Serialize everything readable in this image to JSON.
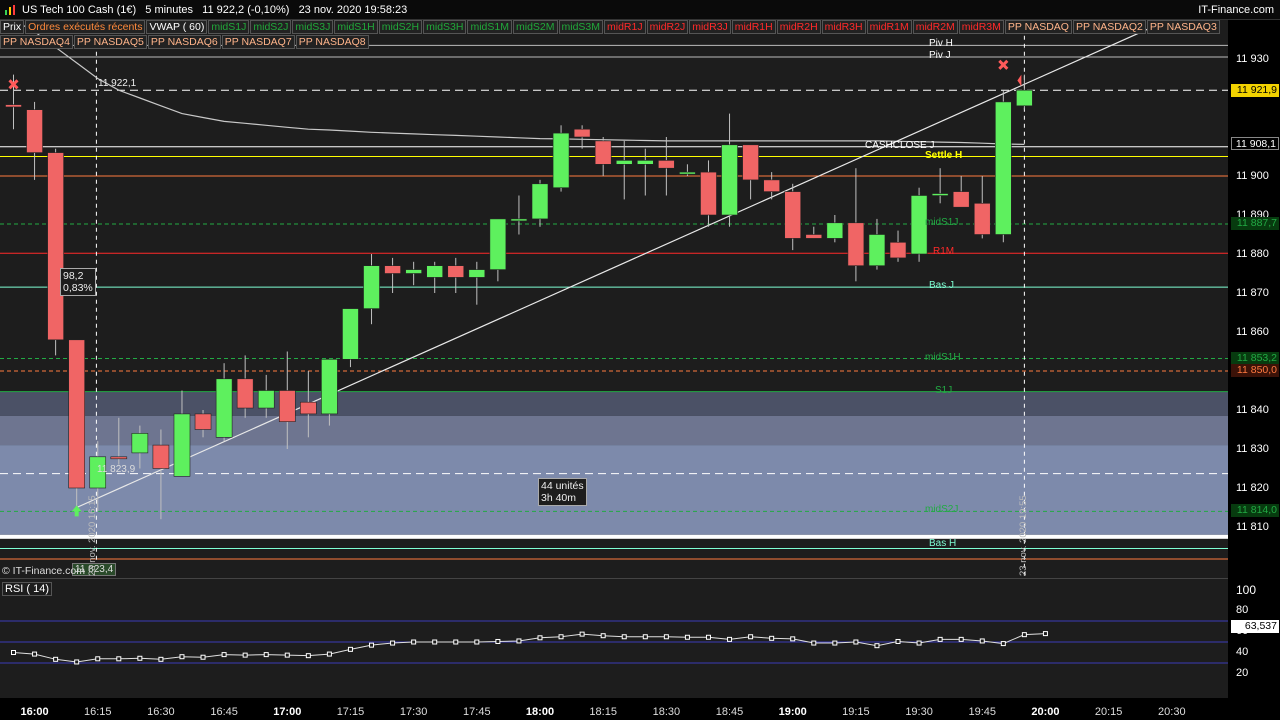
{
  "window": {
    "title": "US Tech 100 Cash (1€)   5 minutes   11 922,2 (-0,10%)   23 nov. 2020 19:58:23",
    "brand": "IT-Finance.com"
  },
  "toolbar": [
    {
      "label": "Prix",
      "color": "white"
    },
    {
      "label": "Ordres exécutés récents",
      "color": "orange"
    },
    {
      "label": "VWAP ( 60)",
      "color": "white"
    },
    {
      "label": "midS1J",
      "color": "green"
    },
    {
      "label": "midS2J",
      "color": "green"
    },
    {
      "label": "midS3J",
      "color": "green"
    },
    {
      "label": "midS1H",
      "color": "green"
    },
    {
      "label": "midS2H",
      "color": "green"
    },
    {
      "label": "midS3H",
      "color": "green"
    },
    {
      "label": "midS1M",
      "color": "green"
    },
    {
      "label": "midS2M",
      "color": "green"
    },
    {
      "label": "midS3M",
      "color": "green"
    },
    {
      "label": "midR1J",
      "color": "red"
    },
    {
      "label": "midR2J",
      "color": "red"
    },
    {
      "label": "midR3J",
      "color": "red"
    },
    {
      "label": "midR1H",
      "color": "red"
    },
    {
      "label": "midR2H",
      "color": "red"
    },
    {
      "label": "midR3H",
      "color": "red"
    },
    {
      "label": "midR1M",
      "color": "red"
    },
    {
      "label": "midR2M",
      "color": "red"
    },
    {
      "label": "midR3M",
      "color": "red"
    },
    {
      "label": "PP NASDAQ",
      "color": "paleorange"
    },
    {
      "label": "PP NASDAQ2",
      "color": "paleorange"
    },
    {
      "label": "PP NASDAQ3",
      "color": "paleorange"
    },
    {
      "label": "PP NASDAQ4",
      "color": "paleorange"
    },
    {
      "label": "PP NASDAQ5",
      "color": "paleorange"
    },
    {
      "label": "PP NASDAQ6",
      "color": "paleorange"
    },
    {
      "label": "PP NASDAQ7",
      "color": "paleorange"
    },
    {
      "label": "PP NASDAQ8",
      "color": "paleorange"
    }
  ],
  "price_axis": {
    "ticks": [
      "11 930",
      "11 900",
      "11 890",
      "11 880",
      "11 870",
      "11 860",
      "11 840",
      "11 830",
      "11 820",
      "11 810"
    ],
    "tick_values": [
      11930,
      11900,
      11890,
      11880,
      11870,
      11860,
      11840,
      11830,
      11820,
      11810
    ]
  },
  "price_boxes": [
    {
      "label": "11 921,9",
      "value": 11921.9,
      "bg": "#f2d200",
      "fg": "#000"
    },
    {
      "label": "11 908,1",
      "value": 11908.1,
      "bg": "#000000",
      "fg": "#ffffff"
    },
    {
      "label": "11 887,7",
      "value": 11887.7,
      "bg": "#073b0f",
      "fg": "#22aa44"
    },
    {
      "label": "11 853,2",
      "value": 11853.2,
      "bg": "#073b0f",
      "fg": "#22aa44"
    },
    {
      "label": "11 850,0",
      "value": 11850.0,
      "bg": "#3b1208",
      "fg": "#ff7a40"
    },
    {
      "label": "11 814,0",
      "value": 11814.0,
      "bg": "#073b0f",
      "fg": "#22aa44"
    }
  ],
  "time_axis": [
    {
      "label": "16:00",
      "bold": true
    },
    {
      "label": "16:15",
      "bold": false
    },
    {
      "label": "16:30",
      "bold": false
    },
    {
      "label": "16:45",
      "bold": false
    },
    {
      "label": "17:00",
      "bold": true
    },
    {
      "label": "17:15",
      "bold": false
    },
    {
      "label": "17:30",
      "bold": false
    },
    {
      "label": "17:45",
      "bold": false
    },
    {
      "label": "18:00",
      "bold": true
    },
    {
      "label": "18:15",
      "bold": false
    },
    {
      "label": "18:30",
      "bold": false
    },
    {
      "label": "18:45",
      "bold": false
    },
    {
      "label": "19:00",
      "bold": true
    },
    {
      "label": "19:15",
      "bold": false
    },
    {
      "label": "19:30",
      "bold": false
    },
    {
      "label": "19:45",
      "bold": false
    },
    {
      "label": "20:00",
      "bold": true
    },
    {
      "label": "20:15",
      "bold": false
    },
    {
      "label": "20:30",
      "bold": false
    }
  ],
  "level_labels": [
    {
      "label": "Piv H",
      "value": 11933.5,
      "color": "#ffffff"
    },
    {
      "label": "Piv J",
      "value": 11930.5,
      "color": "#ffffff"
    },
    {
      "label": "CASHCLOSE J",
      "value": 11907.5,
      "color": "#ffffff"
    },
    {
      "label": "Settle H",
      "value": 11905,
      "color": "#ffff00"
    },
    {
      "label": "midS1J",
      "value": 11887.7,
      "color": "#22aa44"
    },
    {
      "label": "R1M",
      "value": 11880.2,
      "color": "#ff2a2a"
    },
    {
      "label": "Bas J",
      "value": 11871.5,
      "color": "#7fffd4"
    },
    {
      "label": "midS1H",
      "value": 11853.2,
      "color": "#22aa44"
    },
    {
      "label": "S1J",
      "value": 11844.7,
      "color": "#22aa44"
    },
    {
      "label": "midS2J",
      "value": 11814.0,
      "color": "#22aa44"
    },
    {
      "label": "Bas H",
      "value": 11805.5,
      "color": "#7fffd4"
    }
  ],
  "annotations": {
    "cursor_price": "11 922,1",
    "measure_value": "98,2",
    "measure_pct": "0,83%",
    "measure_units": "44 unités",
    "measure_duration": "3h 40m",
    "low_marker": "11 823,9",
    "low_box": "11 823,4",
    "start_time": "23 nov. 2020 16:15",
    "end_time": "23 nov. 2020 19:55",
    "copyright": "© IT-Finance.com"
  },
  "rsi": {
    "label": "RSI ( 14)",
    "value_label": "63,537",
    "value": 63.537,
    "ticks": [
      "100",
      "80",
      "60",
      "40",
      "20"
    ],
    "tick_values": [
      100,
      80,
      60,
      40,
      20
    ],
    "levels": [
      70,
      50,
      30
    ]
  },
  "chart_data": {
    "type": "candlestick",
    "symbol": "US Tech 100 Cash (1€)",
    "timeframe": "5 minutes",
    "ylim": [
      11805,
      11935
    ],
    "x": [
      "15:55",
      "16:00",
      "16:05",
      "16:10",
      "16:15",
      "16:20",
      "16:25",
      "16:30",
      "16:35",
      "16:40",
      "16:45",
      "16:50",
      "16:55",
      "17:00",
      "17:05",
      "17:10",
      "17:15",
      "17:20",
      "17:25",
      "17:30",
      "17:35",
      "17:40",
      "17:45",
      "17:50",
      "17:55",
      "18:00",
      "18:05",
      "18:10",
      "18:15",
      "18:20",
      "18:25",
      "18:30",
      "18:35",
      "18:40",
      "18:45",
      "18:50",
      "18:55",
      "19:00",
      "19:05",
      "19:10",
      "19:15",
      "19:20",
      "19:25",
      "19:30",
      "19:35",
      "19:40",
      "19:45",
      "19:50",
      "19:55"
    ],
    "ohlc": [
      [
        11918.3,
        11926,
        11912,
        11917.7
      ],
      [
        11917,
        11919,
        11899,
        11906
      ],
      [
        11906,
        11907,
        11854,
        11858
      ],
      [
        11858,
        11858,
        11815,
        11820
      ],
      [
        11820,
        11832,
        11814,
        11828
      ],
      [
        11828,
        11838,
        11826,
        11827.5
      ],
      [
        11829,
        11836,
        11825,
        11834
      ],
      [
        11831,
        11835,
        11812,
        11825
      ],
      [
        11823,
        11845,
        11823,
        11839
      ],
      [
        11839,
        11840,
        11833,
        11835
      ],
      [
        11833,
        11852,
        11832,
        11848
      ],
      [
        11848,
        11854,
        11838,
        11840.5
      ],
      [
        11840.5,
        11849,
        11838,
        11845
      ],
      [
        11845,
        11855,
        11830,
        11837
      ],
      [
        11842,
        11850,
        11833,
        11839
      ],
      [
        11839,
        11852,
        11836,
        11853
      ],
      [
        11853,
        11864,
        11851,
        11866
      ],
      [
        11866,
        11880,
        11862,
        11877
      ],
      [
        11877,
        11879,
        11870,
        11875
      ],
      [
        11875,
        11878,
        11872,
        11876
      ],
      [
        11874,
        11878,
        11870,
        11877
      ],
      [
        11877,
        11879,
        11870,
        11874
      ],
      [
        11874,
        11878,
        11867,
        11876
      ],
      [
        11876,
        11888,
        11873,
        11889
      ],
      [
        11889,
        11895,
        11885,
        11889
      ],
      [
        11889,
        11899,
        11887,
        11898
      ],
      [
        11897,
        11913,
        11896,
        11911
      ],
      [
        11912,
        11913,
        11907,
        11910
      ],
      [
        11909,
        11910,
        11900,
        11903
      ],
      [
        11903,
        11909,
        11894,
        11904
      ],
      [
        11903,
        11907,
        11895,
        11904
      ],
      [
        11904,
        11910,
        11895,
        11902
      ],
      [
        11901,
        11903,
        11900,
        11901
      ],
      [
        11901,
        11904,
        11887,
        11890
      ],
      [
        11890,
        11916,
        11887,
        11908
      ],
      [
        11908,
        11908,
        11894,
        11899
      ],
      [
        11899,
        11901,
        11894,
        11896
      ],
      [
        11896,
        11898,
        11881,
        11884
      ],
      [
        11885,
        11887,
        11884,
        11884
      ],
      [
        11884,
        11890,
        11883,
        11888
      ],
      [
        11888,
        11902,
        11873,
        11877
      ],
      [
        11877,
        11889,
        11876,
        11885
      ],
      [
        11883,
        11886,
        11878,
        11879
      ],
      [
        11880,
        11897,
        11878,
        11895
      ],
      [
        11895,
        11902,
        11893,
        11895.5
      ],
      [
        11896,
        11900,
        11892,
        11892
      ],
      [
        11893,
        11900,
        11884,
        11885
      ],
      [
        11885,
        11922,
        11883,
        11919
      ],
      [
        11918,
        11926,
        11917,
        11922
      ]
    ],
    "vwap": [
      11940,
      11937,
      11933,
      11929,
      11925,
      11922,
      11920,
      11918,
      11916,
      11915,
      11914,
      11913.5,
      11913,
      11912.5,
      11912,
      11911.8,
      11911.5,
      11911.2,
      11911,
      11910.8,
      11910.6,
      11910.4,
      11910.2,
      11910,
      11909.8,
      11909.6,
      11909.5,
      11909.4,
      11909.3,
      11909.2,
      11909.1,
      11909,
      11909,
      11909,
      11909,
      11909,
      11909,
      11909,
      11909,
      11909,
      11909,
      11909,
      11908.9,
      11908.8,
      11908.7,
      11908.6,
      11908.4,
      11908.2,
      11908.1
    ],
    "trendline": {
      "from": [
        "16:10",
        11815
      ],
      "to": [
        "20:25",
        11938
      ]
    },
    "markers": [
      {
        "x": "15:55",
        "y": 11923.5,
        "shape": "x"
      },
      {
        "x": "19:50",
        "y": 11928.5,
        "shape": "x"
      },
      {
        "x": "16:10",
        "y": 11814,
        "shape": "arrow-up"
      }
    ],
    "rsi_values": [
      40,
      38.5,
      33.5,
      31,
      34,
      34,
      34.5,
      33.5,
      36,
      35.5,
      38,
      37.5,
      38,
      37.5,
      37,
      38.5,
      43,
      47,
      49,
      50,
      50,
      50,
      50,
      50.5,
      51,
      54,
      55,
      57.5,
      56,
      55,
      55,
      55,
      54.5,
      54.5,
      52.5,
      55,
      53.5,
      53,
      49,
      49,
      50,
      46.5,
      50.5,
      49,
      52.5,
      52.5,
      51,
      48.5,
      57,
      58
    ]
  }
}
